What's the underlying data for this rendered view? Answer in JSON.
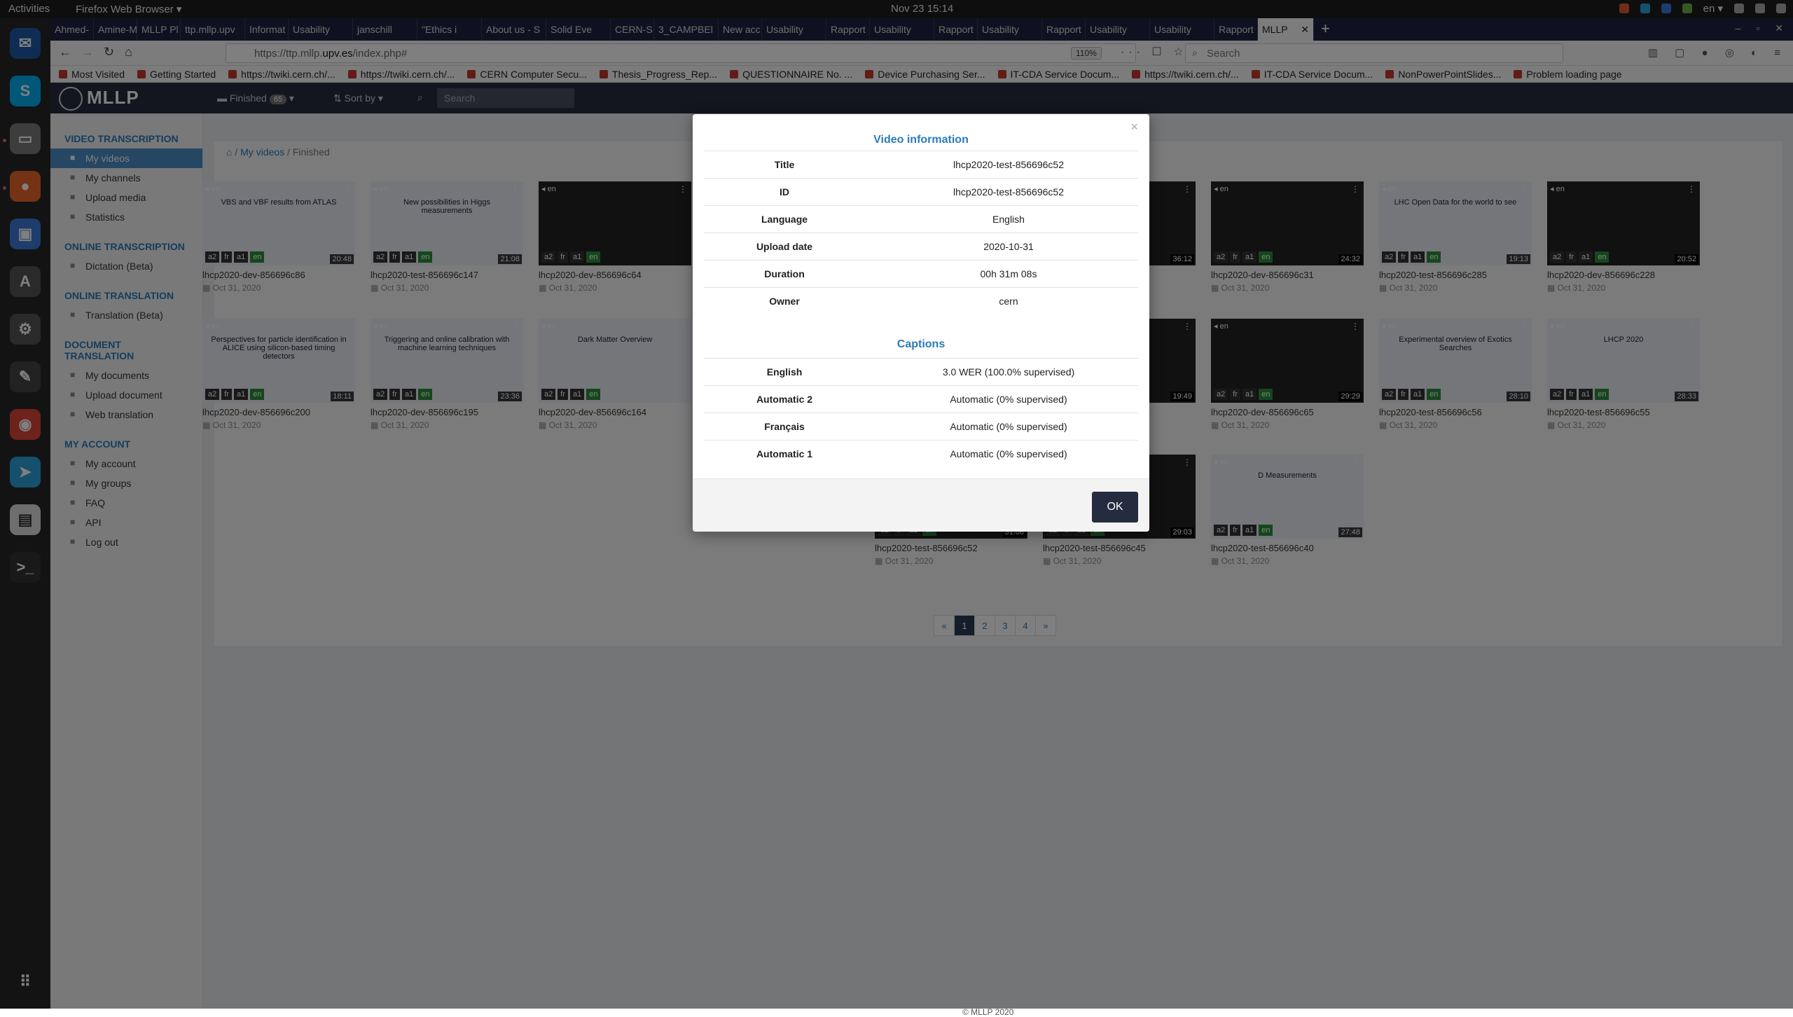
{
  "topbar": {
    "activities": "Activities",
    "app": "Firefox Web Browser ▾",
    "clock": "Nov 23  15:14",
    "lang": "en ▾"
  },
  "tabs": [
    "Ahmed-",
    "Amine-M",
    "MLLP Pl",
    "ttp.mllp.upv",
    "Informat",
    "Usability",
    "janschill",
    "\"Ethics i",
    "About us - S",
    "Solid Eve",
    "CERN-S",
    "3_CAMPBEl",
    "New acc",
    "Usability",
    "Rapport",
    "Usability",
    "Rapport",
    "Usability",
    "Rapport",
    "Usability",
    "Usability",
    "Rapport",
    "MLLP"
  ],
  "url": {
    "prefix": "https://ttp.mllp.",
    "domain": "upv.es",
    "suffix": "/index.php#",
    "zoom": "110%"
  },
  "search": {
    "placeholder": "Search"
  },
  "bookmarks": [
    "Most Visited",
    "Getting Started",
    "https://twiki.cern.ch/...",
    "https://twiki.cern.ch/...",
    "CERN Computer Secu...",
    "Thesis_Progress_Rep...",
    "QUESTIONNAIRE No. ...",
    "Device Purchasing Ser...",
    "IT-CDA Service Docum...",
    "https://twiki.cern.ch/...",
    "IT-CDA Service Docum...",
    "NonPowerPointSlides...",
    "Problem loading page"
  ],
  "app": {
    "logo": "MLLP",
    "filter": "Finished",
    "count": "65",
    "sort": "Sort by",
    "search_placeholder": "Search"
  },
  "sidebar": [
    {
      "h": "VIDEO TRANSCRIPTION",
      "items": [
        {
          "label": "My videos",
          "active": true
        },
        {
          "label": "My channels"
        },
        {
          "label": "Upload media"
        },
        {
          "label": "Statistics"
        }
      ]
    },
    {
      "h": "ONLINE TRANSCRIPTION",
      "items": [
        {
          "label": "Dictation (Beta)"
        }
      ]
    },
    {
      "h": "ONLINE TRANSLATION",
      "items": [
        {
          "label": "Translation (Beta)"
        }
      ]
    },
    {
      "h": "DOCUMENT TRANSLATION",
      "items": [
        {
          "label": "My documents"
        },
        {
          "label": "Upload document"
        },
        {
          "label": "Web translation"
        }
      ]
    },
    {
      "h": "MY ACCOUNT",
      "items": [
        {
          "label": "My account"
        },
        {
          "label": "My groups"
        },
        {
          "label": "FAQ"
        },
        {
          "label": "API"
        },
        {
          "label": "Log out"
        }
      ]
    }
  ],
  "breadcrumb": {
    "home": "⌂",
    "videos": "My videos",
    "current": "Finished"
  },
  "videos": [
    {
      "name": "lhcp2020-dev-856696c86",
      "date": "Oct 31, 2020",
      "dur": "20:48",
      "title": "VBS and VBF results from ATLAS"
    },
    {
      "name": "lhcp2020-test-856696c147",
      "date": "Oct 31, 2020",
      "dur": "21:08",
      "title": "New possibilities in Higgs measurements"
    },
    {
      "name": "lhcp2020-dev-856696c64",
      "date": "Oct 31, 2020",
      "dur": "",
      "title": ""
    },
    {
      "name": "lhcp2020-dev-856696c43",
      "date": "Oct 31, 2020",
      "dur": "36:12",
      "title": ""
    },
    {
      "name": "lhcp2020-dev-856696c31",
      "date": "Oct 31, 2020",
      "dur": "24:32",
      "title": ""
    },
    {
      "name": "lhcp2020-test-856696c285",
      "date": "Oct 31, 2020",
      "dur": "19:13",
      "title": "LHC Open Data for the world to see"
    },
    {
      "name": "lhcp2020-dev-856696c228",
      "date": "Oct 31, 2020",
      "dur": "20:52",
      "title": ""
    },
    {
      "name": "lhcp2020-dev-856696c200",
      "date": "Oct 31, 2020",
      "dur": "18:11",
      "title": "Perspectives for particle identification in ALICE using silicon-based timing detectors"
    },
    {
      "name": "lhcp2020-dev-856696c195",
      "date": "Oct 31, 2020",
      "dur": "23:36",
      "title": "Triggering and online calibration with machine learning techniques"
    },
    {
      "name": "lhcp2020-dev-856696c164",
      "date": "Oct 31, 2020",
      "dur": "",
      "title": "Dark Matter Overview"
    },
    {
      "name": "lhcp2020-dev-856696c117",
      "date": "Oct 31, 2020",
      "dur": "19:49",
      "title": ""
    },
    {
      "name": "lhcp2020-dev-856696c65",
      "date": "Oct 31, 2020",
      "dur": "29:29",
      "title": ""
    },
    {
      "name": "lhcp2020-test-856696c56",
      "date": "Oct 31, 2020",
      "dur": "28:10",
      "title": "Experimental overview of Exotics Searches"
    },
    {
      "name": "lhcp2020-test-856696c55",
      "date": "Oct 31, 2020",
      "dur": "28:33",
      "title": "LHCP 2020"
    },
    {
      "name": "lhcp2020-test-856696c52",
      "date": "Oct 31, 2020",
      "dur": "31:08",
      "title": ""
    },
    {
      "name": "lhcp2020-test-856696c45",
      "date": "Oct 31, 2020",
      "dur": "29:03",
      "title": ""
    },
    {
      "name": "lhcp2020-test-856696c40",
      "date": "Oct 31, 2020",
      "dur": "27:48",
      "title": "D Measurements"
    }
  ],
  "pager": [
    "«",
    "1",
    "2",
    "3",
    "4",
    "»"
  ],
  "footer": "© MLLP 2020",
  "modal": {
    "heading": "Video information",
    "info": [
      {
        "k": "Title",
        "v": "lhcp2020-test-856696c52"
      },
      {
        "k": "ID",
        "v": "lhcp2020-test-856696c52"
      },
      {
        "k": "Language",
        "v": "English"
      },
      {
        "k": "Upload date",
        "v": "2020-10-31"
      },
      {
        "k": "Duration",
        "v": "00h 31m 08s"
      },
      {
        "k": "Owner",
        "v": "cern"
      }
    ],
    "captions_heading": "Captions",
    "captions": [
      {
        "k": "English",
        "v": "3.0 WER (100.0% supervised)"
      },
      {
        "k": "Automatic 2",
        "v": "Automatic (0% supervised)"
      },
      {
        "k": "Français",
        "v": "Automatic (0% supervised)"
      },
      {
        "k": "Automatic 1",
        "v": "Automatic (0% supervised)"
      }
    ],
    "ok": "OK",
    "close": "×"
  },
  "lang_tags": [
    "a2",
    "fr",
    "a1",
    "en"
  ]
}
